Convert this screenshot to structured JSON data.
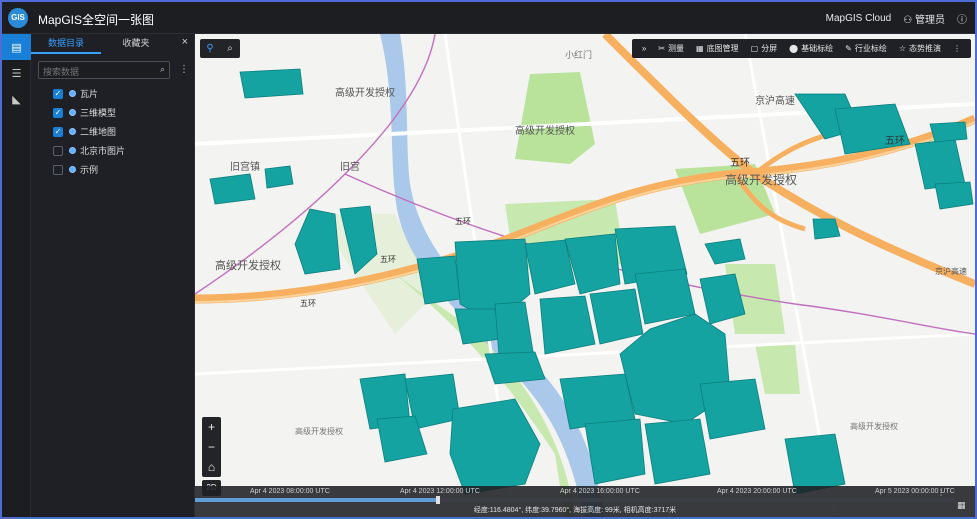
{
  "app": {
    "title": "MapGIS全空间一张图",
    "logo_text": "GIS",
    "cloud_label": "MapGIS Cloud",
    "user_label": "管理员"
  },
  "left_rail": {
    "items": [
      {
        "icon": "layers-icon",
        "glyph": "▤"
      },
      {
        "icon": "list-icon",
        "glyph": "☰"
      },
      {
        "icon": "analysis-icon",
        "glyph": "◣"
      }
    ]
  },
  "panel": {
    "tabs": [
      "数据目录",
      "收藏夹"
    ],
    "active_tab": 0,
    "close_glyph": "×",
    "search": {
      "placeholder": "搜索数据",
      "value": ""
    },
    "tree": [
      {
        "label": "瓦片",
        "checked": true
      },
      {
        "label": "三维模型",
        "checked": true
      },
      {
        "label": "二维地图",
        "checked": true
      },
      {
        "label": "北京市图片",
        "checked": false
      },
      {
        "label": "示例",
        "checked": false
      }
    ]
  },
  "map_toolbar": {
    "items": [
      {
        "label": "测量",
        "icon": "ruler-icon",
        "glyph": "✂"
      },
      {
        "label": "底图管理",
        "icon": "grid-icon",
        "glyph": "▦"
      },
      {
        "label": "分屏",
        "icon": "split-screen-icon",
        "glyph": "▢"
      },
      {
        "label": "基础标绘",
        "icon": "marker-icon",
        "glyph": "⬤"
      },
      {
        "label": "行业标绘",
        "icon": "pen-icon",
        "glyph": "✎"
      },
      {
        "label": "态势推演",
        "icon": "star-icon",
        "glyph": "☆"
      }
    ]
  },
  "map": {
    "labels": {
      "road_wuhuan": "五环",
      "road_jinghu": "京沪高速",
      "road_jinghu_2": "京沪高速",
      "station_jiugong": "旧宫",
      "place_jiugong": "旧宫镇",
      "place_gaoxin1": "高级开发授权",
      "place_gaoxin2": "高级开发授权",
      "place_gaoxin3": "高级开发授权",
      "place_gaoxin4": "高级开发授权",
      "place_xiaohong": "小红门",
      "small_label": "高级开发授权"
    },
    "colors": {
      "building": "#14a3a1",
      "building_top": "#1bb3b1",
      "building_side": "#0c7f7e",
      "road_major": "#f7b060",
      "road_minor": "#ffffff",
      "water": "#a9c8ea",
      "green": "#b9e39b",
      "rail": "#c36fc0",
      "bg": "#f3f3f1"
    }
  },
  "controls": {
    "zoom_in": "+",
    "zoom_out": "−",
    "home_glyph": "⌂",
    "mode": "2D"
  },
  "timeline": {
    "labels": [
      "Apr 4 2023 08:00:00 UTC",
      "Apr 4 2023 12:00:00 UTC",
      "Apr 4 2023 16:00:00 UTC",
      "Apr 4 2023 20:00:00 UTC",
      "Apr 5 2023 00:00:00 UTC"
    ],
    "progress": 0.32,
    "status": "经度:116.4804°, 纬度:39.7960°, 海拔高度: 99米, 相机高度:3717米"
  }
}
